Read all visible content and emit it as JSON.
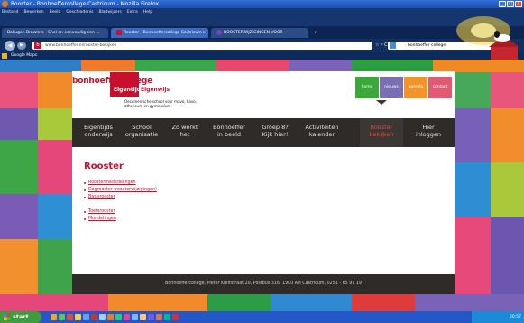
{
  "window": {
    "title": "Rooster - Bonhoeffercollege Castricum - Mozilla Firefox"
  },
  "menu": [
    "Bestand",
    "Bewerken",
    "Beeld",
    "Geschiedenis",
    "Bladwijzers",
    "Extra",
    "Help"
  ],
  "tabs": [
    {
      "label": "Bakugan Brawlers - Snel en eenvoudig een ..."
    },
    {
      "label": "Rooster - Bonhoeffercollege Castricum"
    },
    {
      "label": "ROOSTERWIJZIGINGEN VOOR"
    }
  ],
  "tab_close": "×",
  "tab_new": "+",
  "nav": {
    "back": "◀",
    "forward": "▶",
    "url": "www.bonhoeffer.nl/rooster-bekijken",
    "star": "☆ ▾ C",
    "search_text": "bonhoeffer college",
    "search_btn": "⌕",
    "home": "⌂"
  },
  "bookmarks": [
    "Google Maps"
  ],
  "site": {
    "logo_main": "bonhoeffercollege",
    "logo_sub1": "Eigentijds",
    "logo_sub2": "Eigenwijs",
    "tagline": "Oecumenische school voor mavo, havo, atheneum en gymnasium",
    "topnav": [
      {
        "label": "home",
        "color": "#3aa83a"
      },
      {
        "label": "nieuws",
        "color": "#7a6fb3"
      },
      {
        "label": "agenda",
        "color": "#f2942a"
      },
      {
        "label": "contact",
        "color": "#e05a73"
      }
    ],
    "mainnav": [
      {
        "l1": "Eigentijds",
        "l2": "onderwijs"
      },
      {
        "l1": "School",
        "l2": "organisatie"
      },
      {
        "l1": "Zo werkt",
        "l2": "het"
      },
      {
        "l1": "Bonhoeffer",
        "l2": "in beeld"
      },
      {
        "l1": "Groep 8?",
        "l2": "Kijk hier!"
      },
      {
        "l1": "Activiteiten",
        "l2": "kalender"
      },
      {
        "l1": "Rooster",
        "l2": "bekijken"
      },
      {
        "l1": "Hier",
        "l2": "inloggen"
      }
    ],
    "heading": "Rooster",
    "links1": [
      "Roostermededelingen",
      "Dagrooster (roosterwijzigingen)",
      "Basisrooster"
    ],
    "links2": [
      "Toetsrooster",
      "Mondelingen"
    ],
    "footer": "Bonhoeffercollege, Pieter Kieftstraat 20, Postbus 316, 1900 AH Castricum, 0251 - 65 91 19"
  },
  "taskbar": {
    "start": "start",
    "clock": "20:57"
  }
}
